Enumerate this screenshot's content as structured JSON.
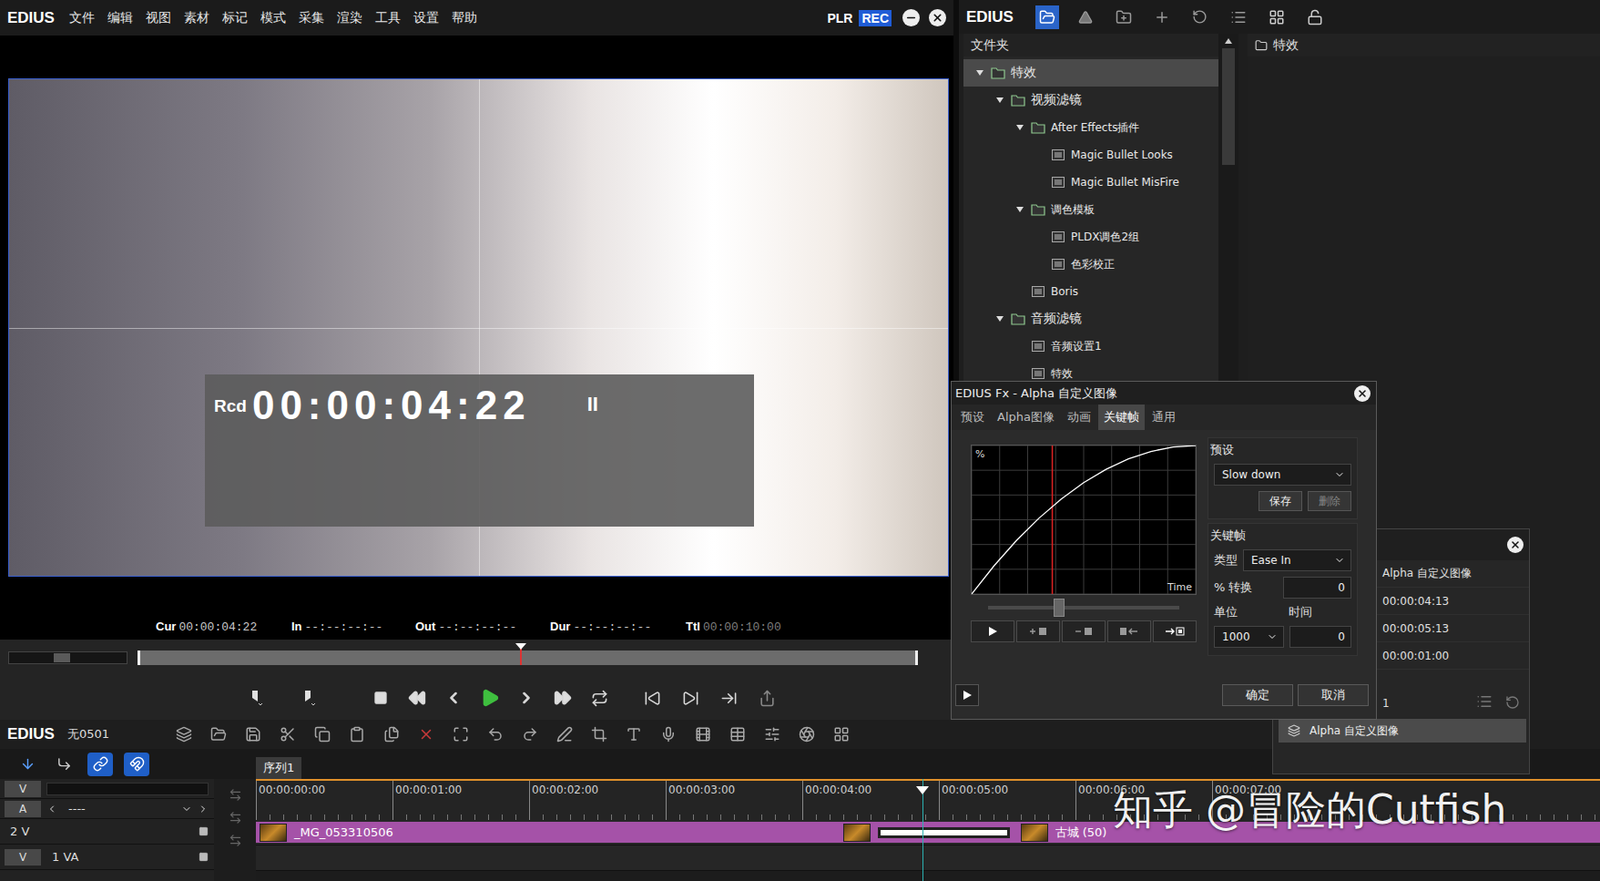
{
  "player": {
    "app_name": "EDIUS",
    "menu": [
      "文件",
      "编辑",
      "视图",
      "素材",
      "标记",
      "模式",
      "采集",
      "渲染",
      "工具",
      "设置",
      "帮助"
    ],
    "mode_buttons": [
      {
        "label": "PLR",
        "selected": false
      },
      {
        "label": "REC",
        "selected": true
      }
    ],
    "overlay": {
      "label": "Rcd",
      "timecode": "00:00:04:22",
      "state": "II"
    },
    "timecodes": [
      {
        "label": "Cur",
        "value": "00:00:04:22",
        "dimmed": false
      },
      {
        "label": "In",
        "value": "--:--:--:--",
        "dimmed": false
      },
      {
        "label": "Out",
        "value": "--:--:--:--",
        "dimmed": false
      },
      {
        "label": "Dur",
        "value": "--:--:--:--",
        "dimmed": false
      },
      {
        "label": "Ttl",
        "value": "00:00:10:00",
        "dimmed": true
      }
    ],
    "zoom": {
      "level": 0.45
    },
    "scrub": {
      "level": 0.49
    }
  },
  "bin": {
    "app_name": "EDIUS",
    "folders_title": "文件夹",
    "content_title": "特效",
    "tree": [
      {
        "label": "特效",
        "depth": 0,
        "kind": "folder",
        "expanded": true,
        "selected": true
      },
      {
        "label": "视频滤镜",
        "depth": 1,
        "kind": "folder",
        "expanded": true,
        "selected": false
      },
      {
        "label": "After Effects插件",
        "depth": 2,
        "kind": "folder",
        "expanded": true,
        "selected": false
      },
      {
        "label": "Magic Bullet Looks",
        "depth": 3,
        "kind": "leaf",
        "selected": false
      },
      {
        "label": "Magic Bullet MisFire",
        "depth": 3,
        "kind": "leaf",
        "selected": false
      },
      {
        "label": "调色模板",
        "depth": 2,
        "kind": "folder",
        "expanded": true,
        "selected": false
      },
      {
        "label": "PLDX调色2组",
        "depth": 3,
        "kind": "leaf",
        "selected": false
      },
      {
        "label": "色彩校正",
        "depth": 3,
        "kind": "leaf",
        "selected": false
      },
      {
        "label": "Boris",
        "depth": 2,
        "kind": "leaf",
        "selected": false
      },
      {
        "label": "音频滤镜",
        "depth": 1,
        "kind": "folder",
        "expanded": true,
        "selected": false
      },
      {
        "label": "音频设置1",
        "depth": 2,
        "kind": "leaf",
        "selected": false
      },
      {
        "label": "特效",
        "depth": 2,
        "kind": "leaf",
        "selected": false
      }
    ]
  },
  "dialog": {
    "title": "EDIUS Fx - Alpha 自定义图像",
    "tabs": [
      {
        "label": "预设",
        "selected": false
      },
      {
        "label": "Alpha图像",
        "selected": false
      },
      {
        "label": "动画",
        "selected": false
      },
      {
        "label": "关键帧",
        "selected": true
      },
      {
        "label": "通用",
        "selected": false
      }
    ],
    "graph": {
      "y_label": "%",
      "x_label": "Time",
      "curve": [
        0,
        19,
        36,
        51,
        64,
        75,
        84,
        91,
        96,
        99,
        100
      ],
      "cursor": 0.36,
      "slider": 0.37
    },
    "preset": {
      "title": "预设",
      "value": "Slow down",
      "buttons": [
        {
          "label": "保存",
          "disabled": false
        },
        {
          "label": "删除",
          "disabled": true
        }
      ]
    },
    "keyframe": {
      "title": "关键帧",
      "type_label": "类型",
      "type_value": "Ease In",
      "percent_label": "% 转换",
      "percent_value": "0",
      "unit_label": "单位",
      "unit_value": "1000",
      "time_label": "时间",
      "time_value": "0"
    },
    "buttons": [
      "确定",
      "取消"
    ]
  },
  "info_panel": {
    "values": [
      "Alpha 自定义图像",
      "00:00:04:13",
      "00:00:05:13",
      "00:00:01:00"
    ],
    "count": "1",
    "item": {
      "label": "Alpha 自定义图像",
      "selected": true
    }
  },
  "timeline": {
    "app_name": "EDIUS",
    "project": "无0501",
    "sequence_tab": "序列1",
    "ruler": [
      "00:00:00:00",
      "00:00:01:00",
      "00:00:02:00",
      "00:00:03:00",
      "00:00:04:00",
      "00:00:05:00",
      "00:00:06:00",
      "00:00:07:00"
    ],
    "playhead_seconds": 4.88,
    "header_rows": [
      {
        "kind": "video-select",
        "tag": "V"
      },
      {
        "kind": "audio-select",
        "tag": "A",
        "label": "----"
      },
      {
        "kind": "track",
        "label": "2 V"
      },
      {
        "kind": "track",
        "tag": "V",
        "label": "1 VA"
      }
    ],
    "tracks": [
      {
        "clips": [
          {
            "kind": "clip",
            "name": "_MG_053310506",
            "start": 0,
            "end": 4.27
          },
          {
            "kind": "transition",
            "start": 4.27,
            "end": 5.57
          },
          {
            "kind": "clip",
            "name": "古城 (50)",
            "start": 5.57,
            "end": 10
          }
        ]
      },
      {
        "clips": []
      }
    ]
  },
  "watermark": "知乎 @冒险的Cutfish"
}
